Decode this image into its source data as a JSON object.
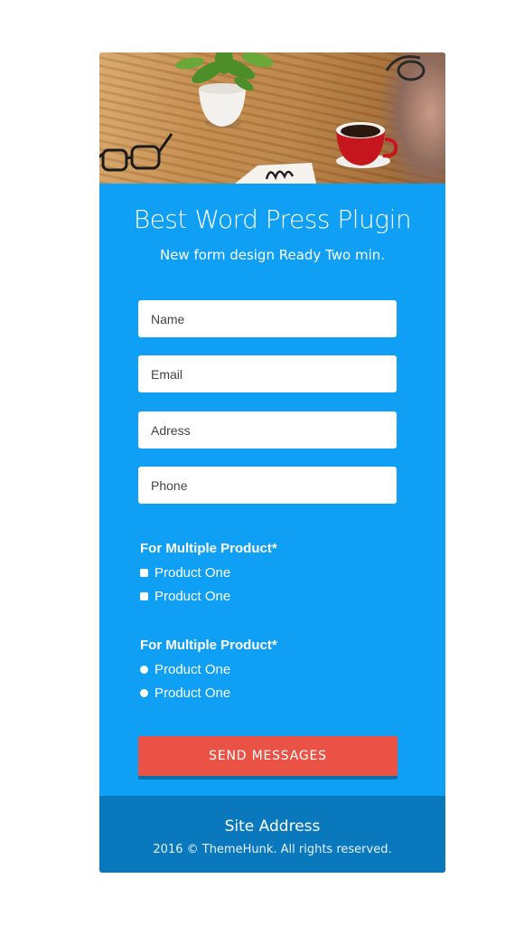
{
  "header": {
    "title": "Best Word Press Plugin",
    "subtitle": "New form design Ready Two min."
  },
  "form": {
    "name_placeholder": "Name",
    "email_placeholder": "Email",
    "address_placeholder": "Adress",
    "phone_placeholder": "Phone"
  },
  "checkbox_group": {
    "title": "For Multiple Product*",
    "options": [
      "Product One",
      "Product One"
    ]
  },
  "radio_group": {
    "title": "For Multiple Product*",
    "options": [
      "Product One",
      "Product One"
    ]
  },
  "submit": {
    "label": "SEND MESSAGES"
  },
  "footer": {
    "address": "Site Address",
    "copyright": "2016 © ThemeHunk. All rights reserved."
  },
  "colors": {
    "card_blue": "#0f9ff4",
    "footer_blue": "#0a78bc",
    "button_red": "#ea5245"
  },
  "icons": {
    "hero": "desk-photo-with-plant-coffee-glasses"
  }
}
